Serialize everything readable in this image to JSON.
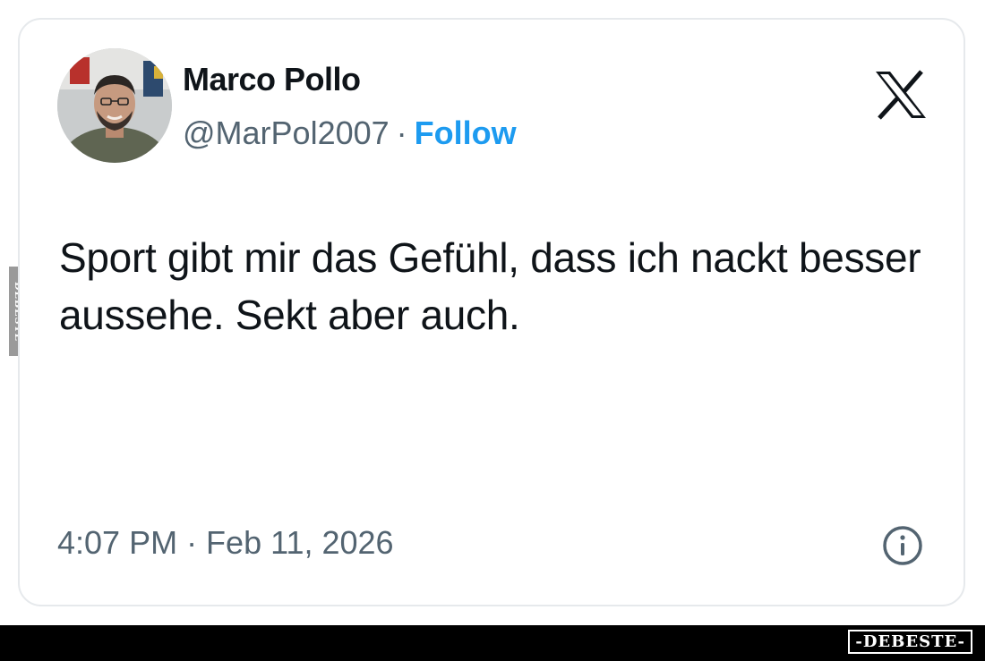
{
  "tweet": {
    "author": {
      "name": "Marco Pollo",
      "handle": "@MarPol2007",
      "separator": "·",
      "follow_label": "Follow"
    },
    "text": "Sport gibt mir das Gefühl, dass ich nackt besser aussehe. Sekt aber auch.",
    "timestamp": "4:07 PM · Feb 11, 2026",
    "icons": {
      "platform": "x-logo-icon",
      "info": "info-icon"
    }
  },
  "watermark": {
    "side": "DEBESTE",
    "footer": "-DEBESTE-"
  },
  "colors": {
    "text": "#0f1419",
    "secondary": "#536471",
    "follow": "#1d9bf0",
    "card_border": "#e6e9ec",
    "footer_bar": "#000000"
  }
}
